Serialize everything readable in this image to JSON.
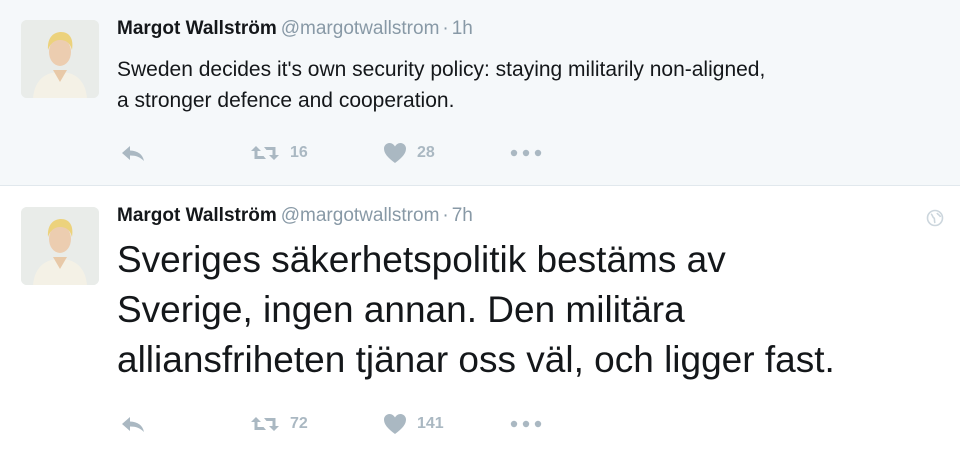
{
  "tweets": [
    {
      "name": "Margot Wallström",
      "handle": "@margotwallstrom",
      "separator": "·",
      "time": "1h",
      "text_lines": [
        "Sweden decides it's own security policy: staying militarily non-aligned,",
        "a stronger defence and cooperation."
      ],
      "retweets": "16",
      "likes": "28",
      "icons": [
        "reply-icon",
        "retweet-icon",
        "like-icon",
        "more-icon"
      ]
    },
    {
      "name": "Margot Wallström",
      "handle": "@margotwallstrom",
      "separator": "·",
      "time": "7h",
      "text_lines": [
        "Sveriges säkerhetspolitik bestäms av",
        "Sverige, ingen annan. Den militära",
        "alliansfriheten tjänar oss väl, och ligger fast."
      ],
      "retweets": "72",
      "likes": "141",
      "icons": [
        "globe-icon",
        "reply-icon",
        "retweet-icon",
        "like-icon",
        "more-icon"
      ]
    }
  ],
  "colors": {
    "highlight_background": "#f5f8fa",
    "name": "#14171a",
    "meta": "#8899a6",
    "action_icons": "#aab8c2"
  }
}
